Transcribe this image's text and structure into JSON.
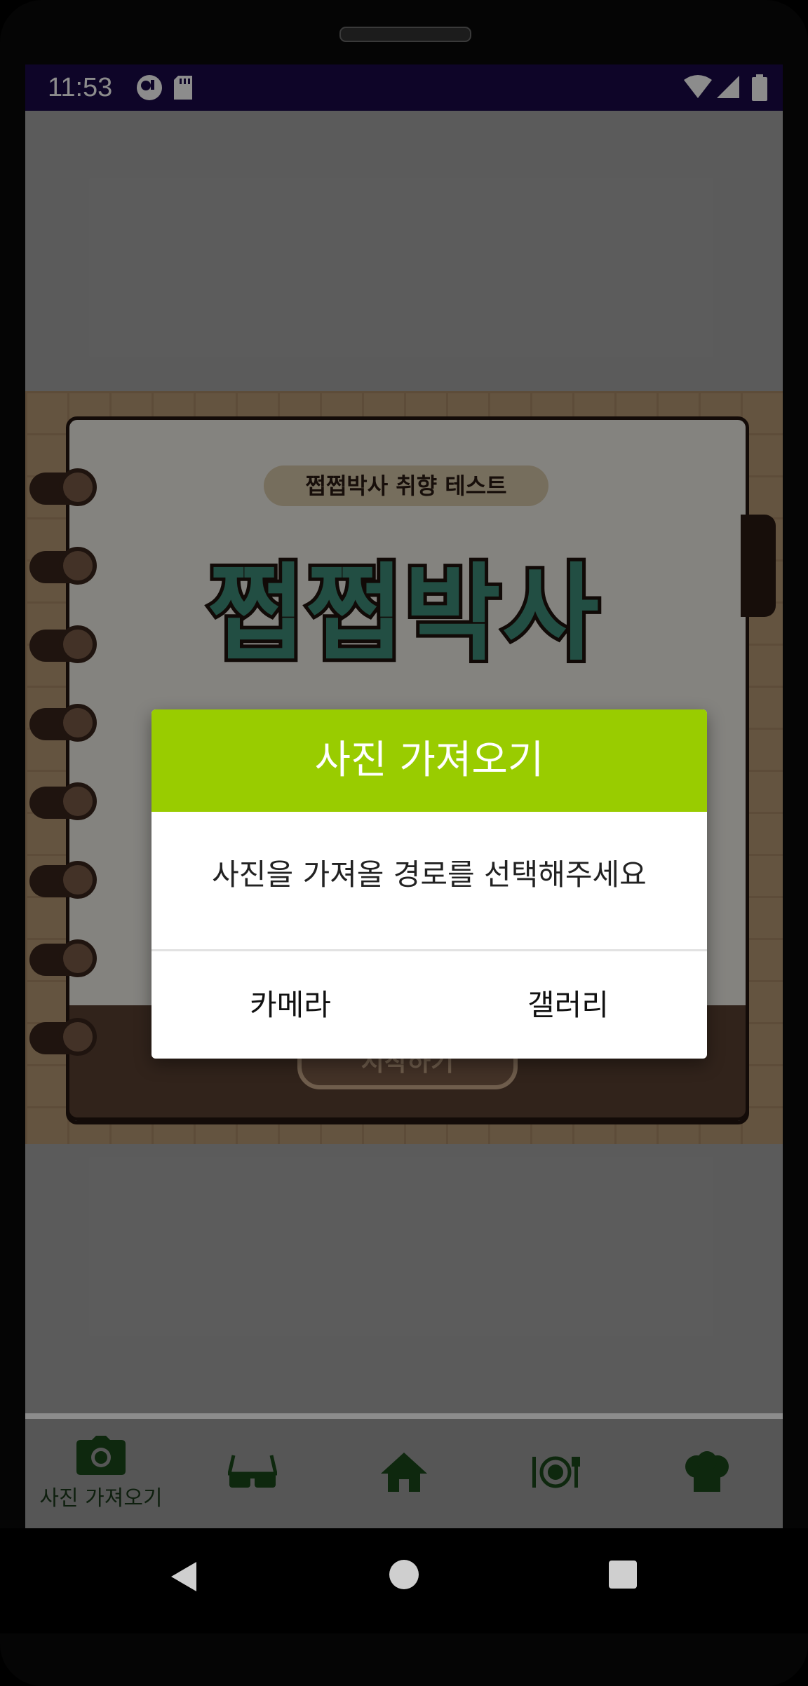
{
  "status_bar": {
    "time": "11:53",
    "left_icons": [
      "assistant-icon",
      "sd-card-icon"
    ],
    "right_icons": [
      "wifi-icon",
      "signal-icon",
      "battery-icon"
    ],
    "background": "#1b0a4a"
  },
  "cover": {
    "pill_text": "쩝쩝박사 취향 테스트",
    "title": "쩝쩝박사",
    "start_button": "시작하기",
    "title_color": "#3f8f7a"
  },
  "dialog": {
    "title": "사진 가져오기",
    "message": "사진을 가져올 경로를 선택해주세요",
    "buttons": {
      "camera": "카메라",
      "gallery": "갤러리"
    },
    "header_color": "#99cc00"
  },
  "bottom_nav": {
    "items": [
      {
        "icon": "camera-icon",
        "label": "사진 가져오기",
        "selected": true
      },
      {
        "icon": "glasses-icon",
        "label": ""
      },
      {
        "icon": "home-icon",
        "label": ""
      },
      {
        "icon": "dining-icon",
        "label": ""
      },
      {
        "icon": "chef-hat-icon",
        "label": ""
      }
    ],
    "icon_color": "#1a4a1a"
  },
  "system_nav": {
    "buttons": [
      "back-icon",
      "home-circle-icon",
      "recents-icon"
    ]
  }
}
